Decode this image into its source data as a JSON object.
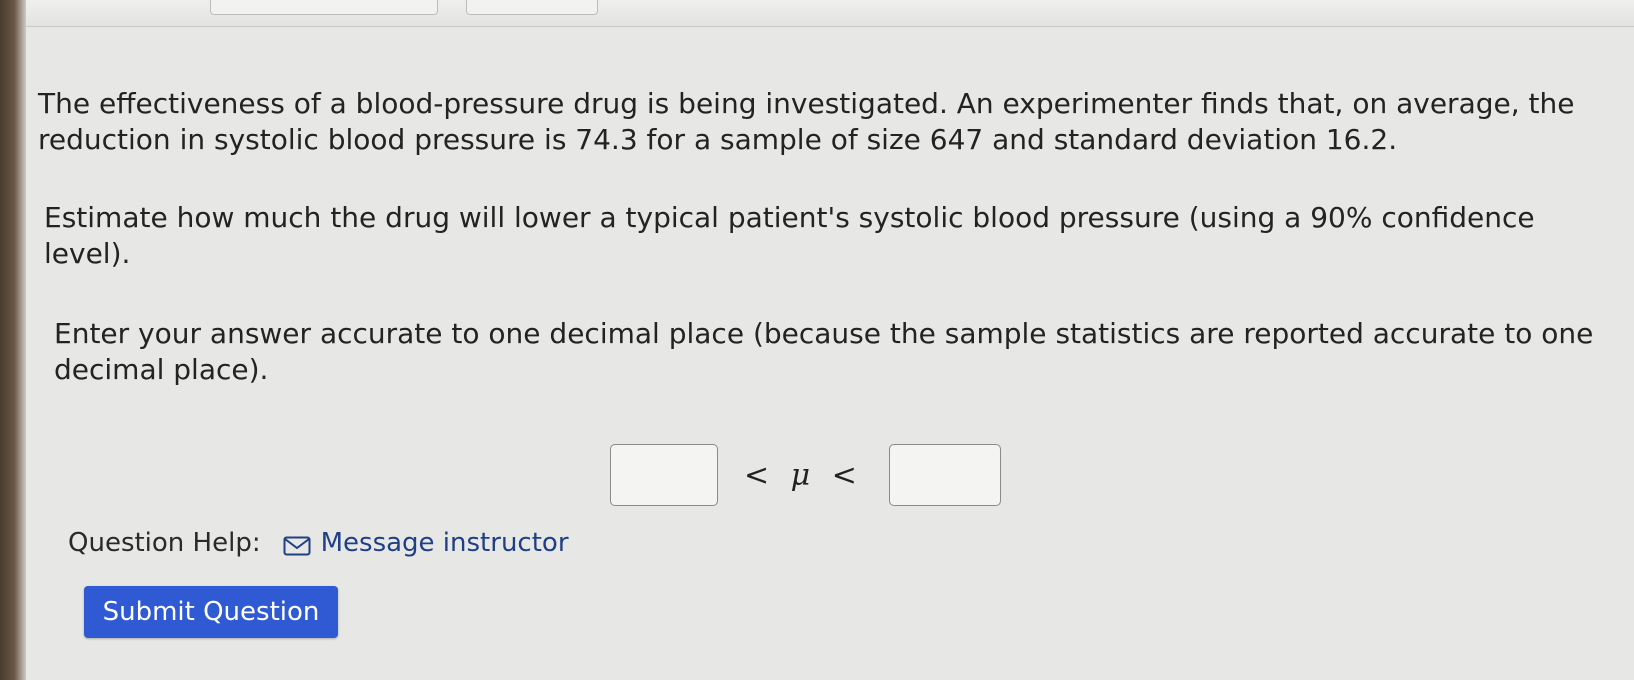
{
  "question": {
    "paragraph_1": "The effectiveness of a blood-pressure drug is being investigated. An experimenter finds that, on average, the reduction in systolic blood pressure is 74.3 for a sample of size 647 and standard deviation 16.2.",
    "paragraph_2": "Estimate how much the drug will lower a typical patient's systolic blood pressure (using a 90% confidence level).",
    "paragraph_3": "Enter your answer accurate to one decimal place (because the sample statistics are reported accurate to one decimal place)."
  },
  "answer": {
    "lower_value": "",
    "inequality_text": "< μ <",
    "upper_value": ""
  },
  "help": {
    "label": "Question Help:",
    "icon": "envelope-icon",
    "link_text": "Message instructor"
  },
  "submit": {
    "label": "Submit Question"
  },
  "colors": {
    "submit_button": "#2f5ad3",
    "link": "#1f3f86",
    "background": "#e7e7e5"
  }
}
